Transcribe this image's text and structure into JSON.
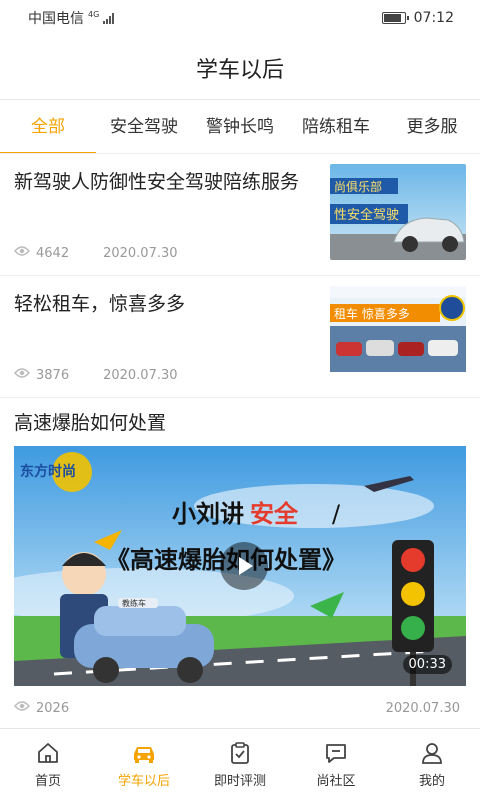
{
  "status": {
    "carrier": "中国电信",
    "network": "4G",
    "time": "07:12"
  },
  "header": {
    "title": "学车以后"
  },
  "tabs": [
    {
      "label": "全部",
      "active": true
    },
    {
      "label": "安全驾驶"
    },
    {
      "label": "警钟长鸣"
    },
    {
      "label": "陪练租车"
    },
    {
      "label": "更多服"
    }
  ],
  "articles": [
    {
      "title": "新驾驶人防御性安全驾驶陪练服务",
      "views": "4642",
      "date": "2020.07.30",
      "thumb_text": [
        "尚俱乐部",
        "性安全驾驶"
      ]
    },
    {
      "title": "轻松租车，惊喜多多",
      "views": "3876",
      "date": "2020.07.30",
      "thumb_text": [
        "租车  惊喜多多"
      ]
    },
    {
      "title": "高速爆胎如何处置",
      "views": "2026",
      "date": "2020.07.30",
      "duration": "00:33",
      "video_text": [
        "东方时尚",
        "小刘讲",
        "安全",
        "《高速爆胎如何处置》",
        "教练车"
      ]
    }
  ],
  "tabbar": [
    {
      "label": "首页",
      "icon": "home-icon"
    },
    {
      "label": "学车以后",
      "icon": "car-icon",
      "active": true
    },
    {
      "label": "即时评测",
      "icon": "clipboard-check-icon"
    },
    {
      "label": "尚社区",
      "icon": "chat-icon"
    },
    {
      "label": "我的",
      "icon": "user-icon"
    }
  ],
  "colors": {
    "accent": "#f5a300",
    "text": "#222222",
    "muted": "#999999"
  }
}
